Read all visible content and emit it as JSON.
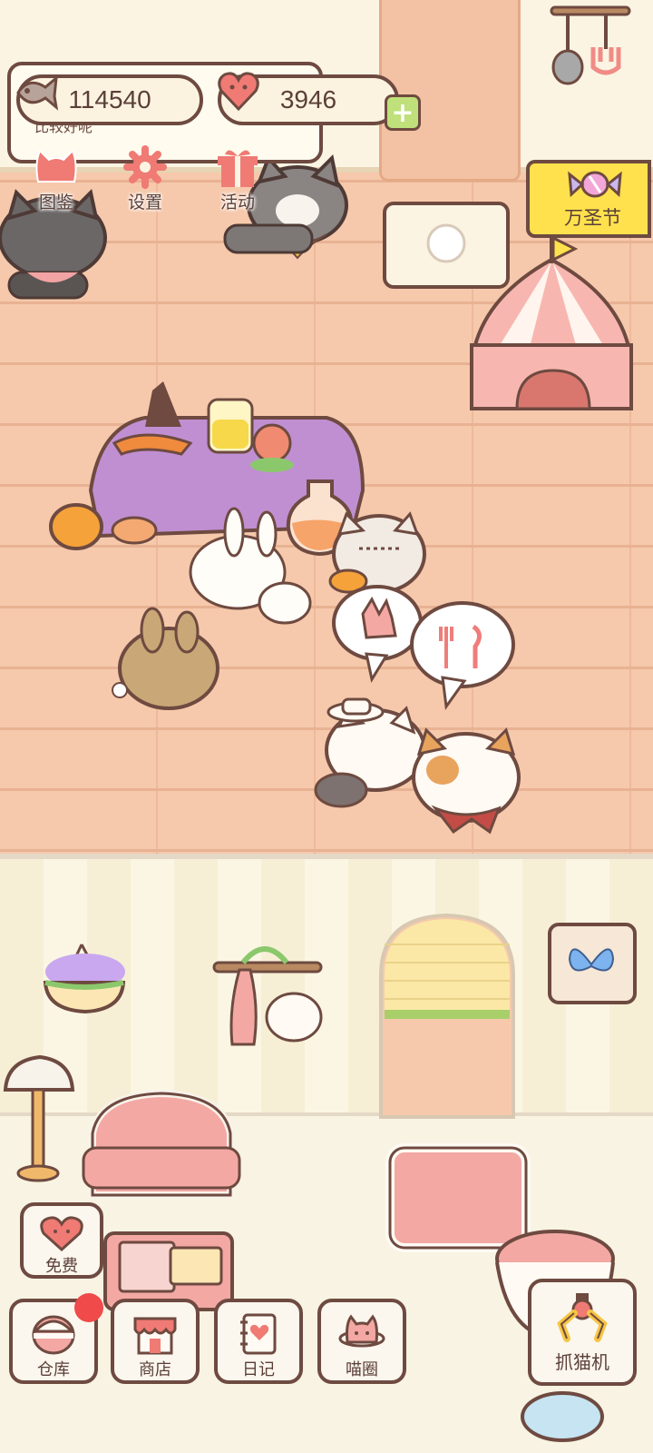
{
  "currency": {
    "fish_coins": "114540",
    "hearts": "3946",
    "hint_text": "比较好呢"
  },
  "top_menu": [
    {
      "label": "图鉴"
    },
    {
      "label": "设置"
    },
    {
      "label": "活动"
    }
  ],
  "event": {
    "label": "万圣节"
  },
  "bottom_menu": {
    "free": "免费",
    "warehouse": "仓库",
    "shop": "商店",
    "diary": "日记",
    "cat_circle": "喵圈",
    "claw_machine": "抓猫机"
  },
  "colors": {
    "floor": "#f6c9ac",
    "outline": "#6e4a40",
    "event_flag": "#ffe14d",
    "notification": "#f04a4a",
    "plus_button": "#bfe07a"
  },
  "bubbles": [
    "paw-icon",
    "fork-spoon-icon"
  ]
}
